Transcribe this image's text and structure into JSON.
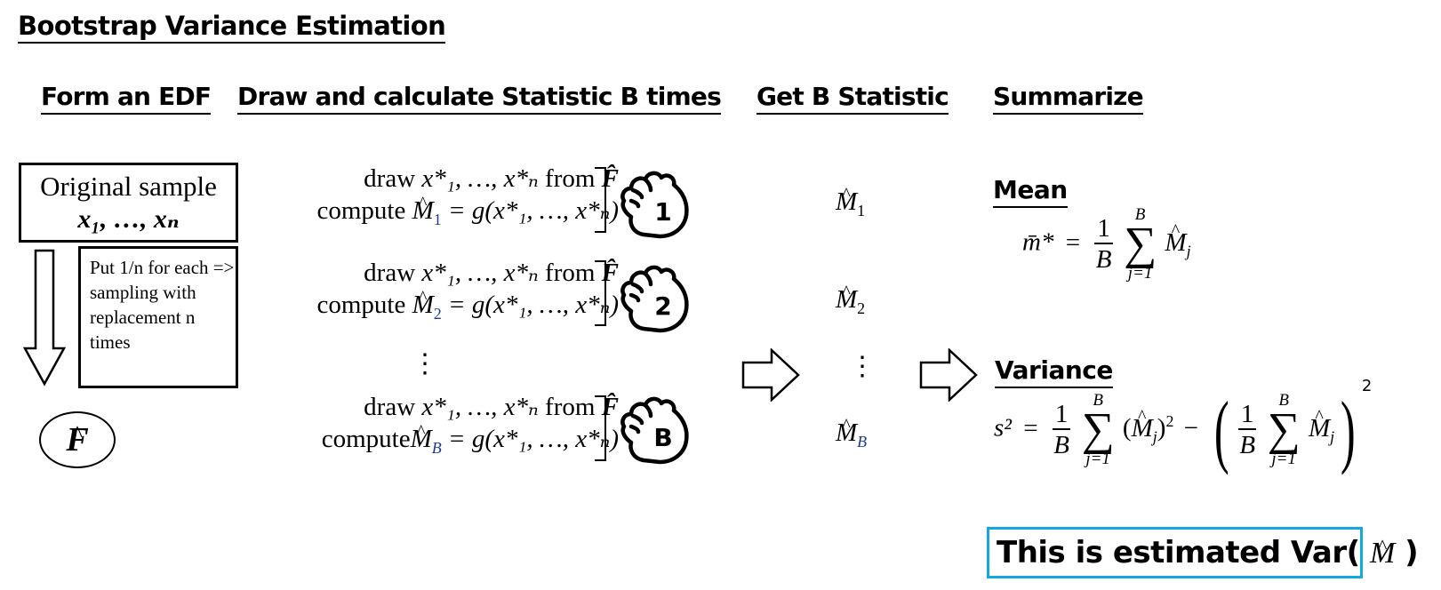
{
  "title": "Bootstrap Variance Estimation",
  "sections": {
    "form_edf": "Form an EDF",
    "draw_calc": "Draw and calculate Statistic B times",
    "get_stat": "Get B Statistic",
    "summarize": "Summarize"
  },
  "edf": {
    "original_sample_label": "Original sample",
    "original_sample_values": "x₁, …, xₙ",
    "note": "Put 1/n for each => sampling with replacement n times",
    "edf_symbol": "F̂",
    "hat_glyph": "^",
    "letter": "F"
  },
  "draws": [
    {
      "draw_text": "draw",
      "sample": "x*₁, …, x*ₙ",
      "from_text": "from",
      "compute_text": "compute",
      "stat_letter": "M",
      "stat_index": "1",
      "eq": "= g(x*₁, …, x*ₙ)",
      "hand_label": "1"
    },
    {
      "draw_text": "draw",
      "sample": "x*₁, …, x*ₙ",
      "from_text": "from",
      "compute_text": "compute",
      "stat_letter": "M",
      "stat_index": "2",
      "eq": "= g(x*₁, …, x*ₙ)",
      "hand_label": "2"
    },
    {
      "draw_text": "draw",
      "sample": "x*₁, …, x*ₙ",
      "from_text": "from",
      "compute_text": "compute",
      "stat_letter": "M",
      "stat_index": "B",
      "eq": "= g(x*₁, …, x*ₙ)",
      "hand_label": "B"
    }
  ],
  "ellipsis_vertical": "⋮",
  "statistics": [
    {
      "letter": "M",
      "index": "1"
    },
    {
      "letter": "M",
      "index": "2"
    },
    {
      "letter": "M",
      "index": "B"
    }
  ],
  "summary": {
    "mean_label": "Mean",
    "mean_lhs": "m̄*",
    "variance_label": "Variance",
    "variance_lhs": "s²",
    "frac_num": "1",
    "frac_den": "B",
    "sum_upper": "B",
    "sum_lower": "j=1",
    "sum_symbol": "∑",
    "term_letter": "M",
    "term_index": "j",
    "equals": "=",
    "minus": "−",
    "square": "2",
    "result_text": "This is estimated Var(",
    "result_symbol": "M",
    "result_close": ")"
  },
  "colors": {
    "result_border": "#13a9e0",
    "index_color": "#1f3c88"
  }
}
